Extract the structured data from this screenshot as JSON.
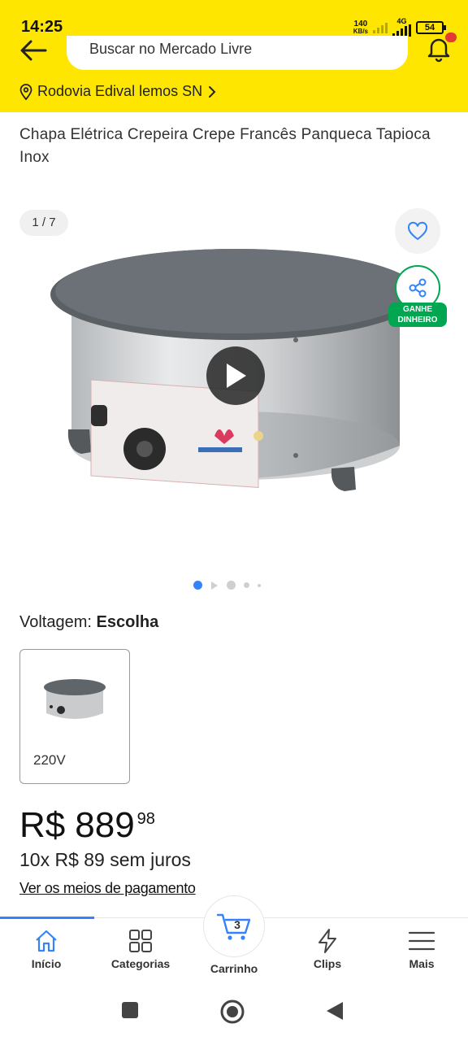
{
  "status_bar": {
    "time": "14:25",
    "net_speed_value": "140",
    "net_speed_unit": "KB/s",
    "network_type": "4G",
    "battery": "54"
  },
  "header": {
    "search_placeholder": "Buscar no Mercado Livre",
    "notification_badge": "",
    "location": "Rodovia Edival lemos SN",
    "background_color": "#ffe600"
  },
  "product": {
    "title": "Chapa Elétrica Crepeira Crepe Francês Panqueca Tapioca Inox",
    "image_counter": "1 / 7",
    "share_label_line1": "GANHE",
    "share_label_line2": "DINHEIRO",
    "image_count": 7,
    "current_image": 1
  },
  "variation": {
    "label": "Voltagem:",
    "value": "Escolha",
    "options": [
      {
        "name": "220V"
      }
    ]
  },
  "price": {
    "currency": "R$",
    "integer": "889",
    "cents": "98",
    "installments": "10x R$ 89  sem juros",
    "payment_link": "Ver os meios de pagamento"
  },
  "bottom_nav": {
    "items": [
      {
        "label": "Início",
        "icon": "home-icon",
        "active": true
      },
      {
        "label": "Categorias",
        "icon": "grid-icon",
        "active": false
      },
      {
        "label": "Carrinho",
        "icon": "cart-icon",
        "active": false,
        "badge": "3"
      },
      {
        "label": "Clips",
        "icon": "bolt-icon",
        "active": false
      },
      {
        "label": "Mais",
        "icon": "menu-icon",
        "active": false
      }
    ]
  },
  "colors": {
    "accent_blue": "#3483fa",
    "green": "#00a650",
    "yellow": "#ffe600"
  }
}
